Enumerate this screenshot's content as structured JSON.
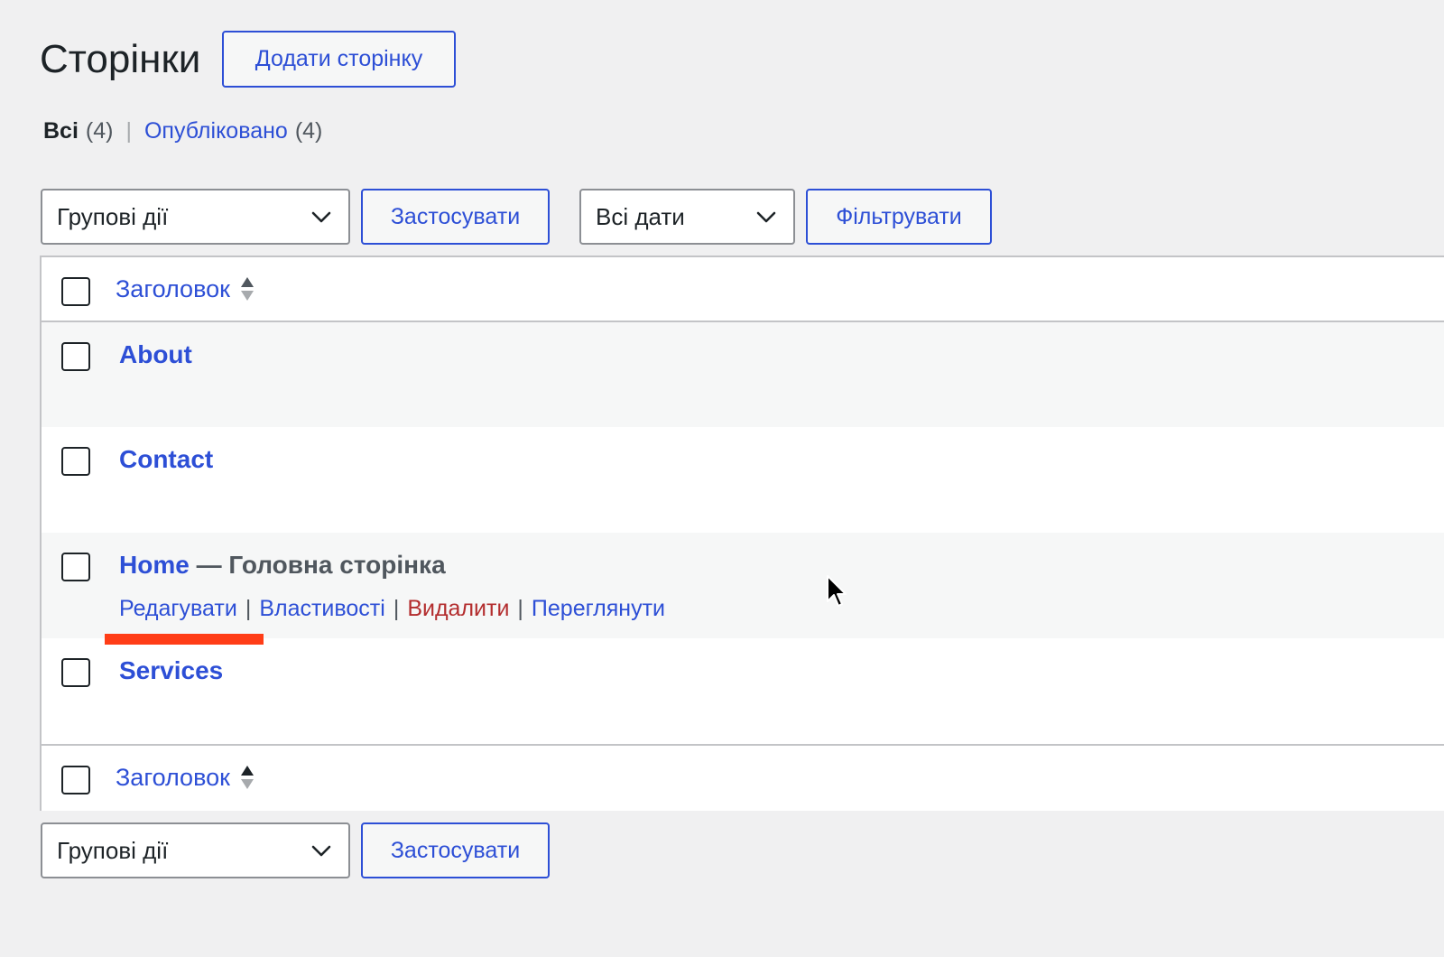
{
  "header": {
    "title": "Сторінки",
    "add_button": "Додати сторінку"
  },
  "filters": {
    "all_label": "Всі",
    "all_count": "(4)",
    "separator": "|",
    "published_label": "Опубліковано",
    "published_count": "(4)"
  },
  "tablenav_top": {
    "bulk_actions": "Групові дії",
    "apply_button": "Застосувати",
    "dates_select": "Всі дати",
    "filter_button": "Фільтрувати"
  },
  "table": {
    "column_title": "Заголовок",
    "rows": [
      {
        "title": "About"
      },
      {
        "title": "Contact"
      },
      {
        "title": "Home",
        "state": " — Головна сторінка",
        "actions": {
          "edit": "Редагувати",
          "properties": "Властивості",
          "delete": "Видалити",
          "view": "Переглянути"
        }
      },
      {
        "title": "Services"
      }
    ],
    "action_separator": "|",
    "footer_column_title": "Заголовок"
  },
  "tablenav_bottom": {
    "bulk_actions": "Групові дії",
    "apply_button": "Застосувати"
  },
  "colors": {
    "accent": "#2d4fd6",
    "delete": "#b32d2e",
    "highlight_mark": "#ff3d17",
    "background": "#f0f0f1"
  },
  "icons": {
    "select_arrow": "chevron-down-icon",
    "sort": "sort-arrows-icon",
    "cursor": "mouse-pointer-icon"
  }
}
